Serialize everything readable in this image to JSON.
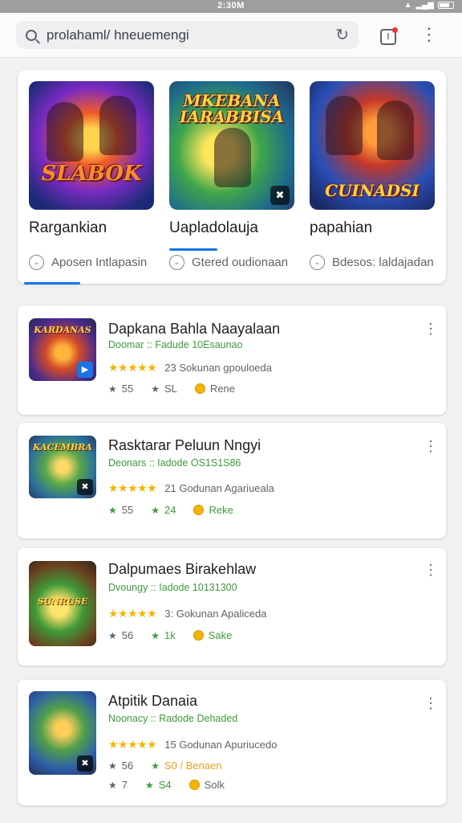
{
  "status": {
    "time": "2:30M"
  },
  "search": {
    "query": "prolahaml/ hneuemengi"
  },
  "featured": [
    {
      "art_text": "SLABOK",
      "name": "Rargankian",
      "sub": "Aposen Intlapasin"
    },
    {
      "art_text": "MKEBANA IARABBISA",
      "name": "Uapladolauja",
      "sub": "Gtered oudionaan"
    },
    {
      "art_text": "CUINADSI",
      "name": "papahian",
      "sub": "Bdesos: laldajadan"
    }
  ],
  "apps": [
    {
      "title": "Dapkana Bahla Naayalaan",
      "developer": "Doomar :: Fadude 10Esaunao",
      "stars": "★★★★★",
      "rating_text": "23 Sokunan gpouloeda",
      "stats": [
        {
          "icon": "★",
          "value": "55"
        },
        {
          "icon": "★",
          "value": "SL"
        },
        {
          "icon": "●",
          "value": "Rene"
        }
      ],
      "icon_word": "KARDANAS"
    },
    {
      "title": "Rasktarar Peluun Nngyi",
      "developer": "Deonars :: Iadode OS1S1S86",
      "stars": "★★★★★",
      "rating_text": "21 Godunan Agariueala",
      "stats": [
        {
          "icon": "★",
          "value": "55"
        },
        {
          "icon": "★",
          "value": "24"
        },
        {
          "icon": "●",
          "value": "Reke"
        }
      ],
      "icon_word": "KACEMBRA"
    },
    {
      "title": "Dalpumaes Birakehlaw",
      "developer": "Dvoungy :: Iadode 10131300",
      "stars": "★★★★★",
      "rating_text": "3: Gokunan Apaliceda",
      "stats": [
        {
          "icon": "★",
          "value": "56"
        },
        {
          "icon": "★",
          "value": "1k"
        },
        {
          "icon": "●",
          "value": "Sake"
        }
      ],
      "icon_word": "SUNRUSE"
    },
    {
      "title": "Atpitik Danaia",
      "developer": "Noonacy :: Radode Dehaded",
      "stars": "★★★★★",
      "rating_text": "15 Godunan Apuriucedo",
      "stats": [
        {
          "icon": "★",
          "value": "56"
        },
        {
          "icon": "★",
          "value": "S0 / Benaen"
        }
      ],
      "stats2": [
        {
          "icon": "★",
          "value": "7"
        },
        {
          "icon": "★",
          "value": "S4"
        },
        {
          "icon": "●",
          "value": "Solk"
        }
      ]
    }
  ]
}
